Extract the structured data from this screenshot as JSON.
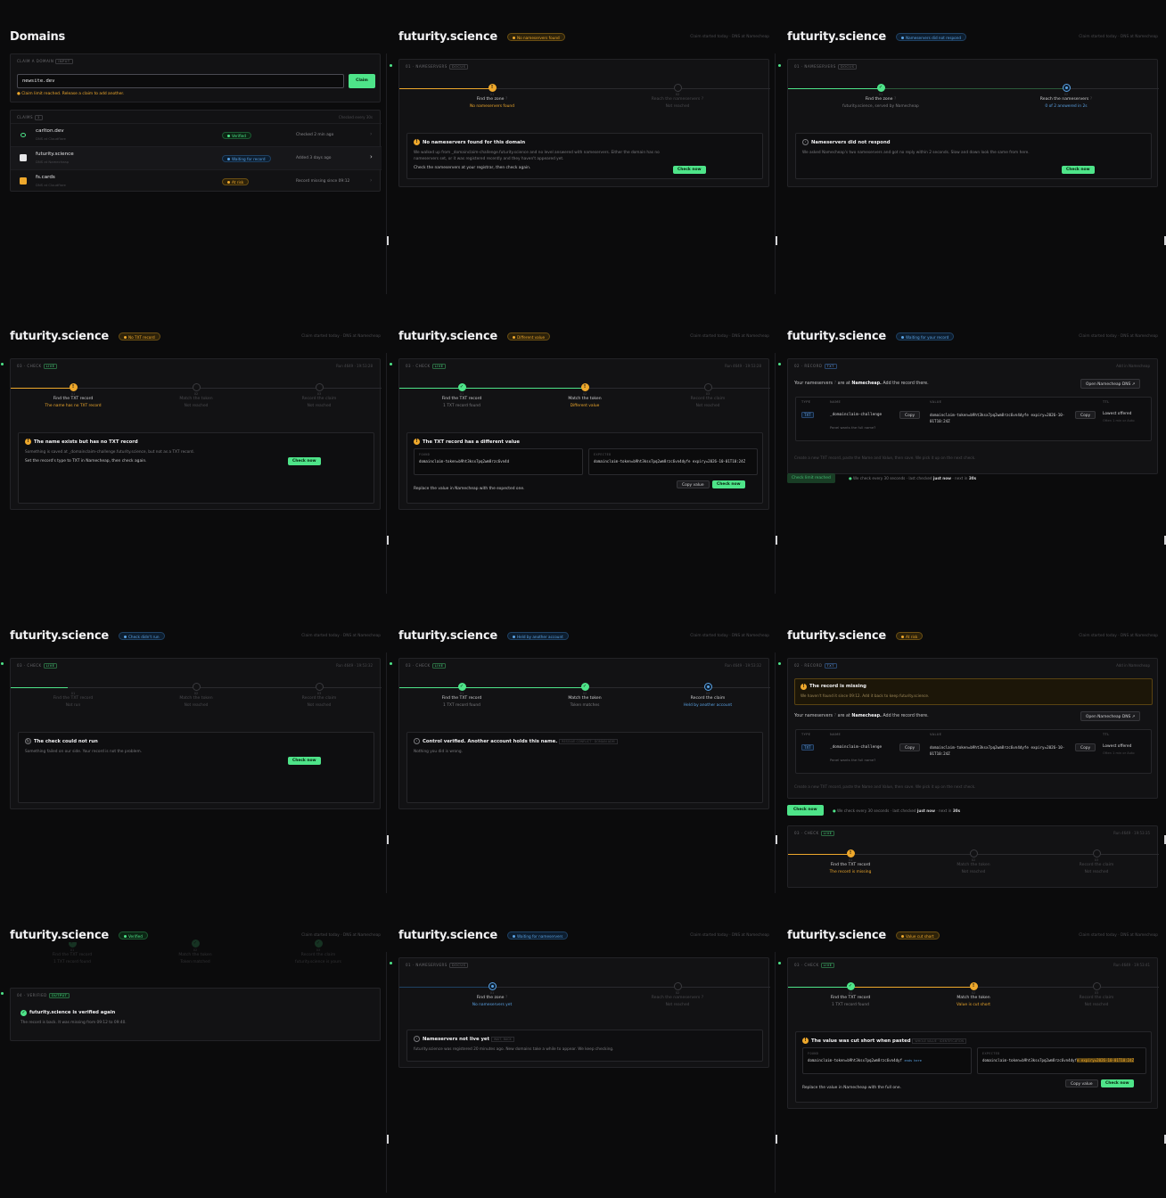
{
  "p1": {
    "title": "Domains",
    "card_label": "CLAIM A DOMAIN",
    "card_tag": "INPUT",
    "input_value": "newsite.dev",
    "claim_btn": "Claim",
    "limit_msg": "Claim limit reached. Release a claim to add another.",
    "claims_label": "CLAIMS",
    "claims_count": "3",
    "checked_every": "Checked every 30s",
    "rows": [
      {
        "name": "carlton.dev",
        "sub": "DNS at Cloudflare",
        "badge": "Verified",
        "status": "Checked 2 min ago"
      },
      {
        "name": "futurity.science",
        "sub": "DNS at Namecheap",
        "badge": "Waiting for record",
        "status": "Added 3 days ago"
      },
      {
        "name": "fs.cards",
        "sub": "DNS at Cloudflare",
        "badge": "At risk",
        "status": "Record missing since 09:12"
      }
    ]
  },
  "common": {
    "domain": "futurity.science",
    "meta": "Claim started today · DNS at Namecheap",
    "ns_head": "01 · NAMESERVERS",
    "ns_tag": "DOCUS",
    "check_head": "03 · CHECK",
    "live": "LIVE",
    "record_head": "02 · RECORD",
    "txt": "TXT",
    "add_at": "Add in Namecheap",
    "verified_head": "04 · VERIFIED",
    "output": "OUTPUT",
    "find_zone": "Find the zone",
    "reach_ns": "Reach the nameservers",
    "find_txt": "Find the TXT record",
    "match_token": "Match the token",
    "record_claim": "Record the claim",
    "not_reached": "Not reached",
    "check_now": "Check now",
    "copy": "Copy",
    "copy_value": "Copy value",
    "found_label": "FOUND",
    "expected_label": "EXPECTED",
    "s01": "01",
    "s02": "02",
    "s03": "03",
    "q": "?"
  },
  "p2": {
    "badge": "No nameservers found",
    "sub1": "No nameservers found",
    "box_title": "No nameservers found for this domain",
    "box_body": "We walked up from _domainclaim-challenge.futurity.science and no level answered with nameservers. Either the domain has no nameservers set, or it was registered recently and they haven't appeared yet.",
    "box_action": "Check the nameservers at your registrar, then check again."
  },
  "p3": {
    "badge": "Nameservers did not respond",
    "sub1": "futurity.science, served by Namecheap",
    "sub2": "0 of 2 answered in 2s",
    "box_title": "Nameservers did not respond",
    "box_body": "We asked Namecheap's two nameservers and got no reply within 2 seconds. Slow and down look the same from here."
  },
  "p4": {
    "badge": "No TXT record",
    "run": "Run 4649 · 19:53:28",
    "sub1": "The name has no TXT record",
    "box_title": "The name exists but has no TXT record",
    "box_body": "Something is saved at _domainclaim-challenge.futurity.science, but not as a TXT record.",
    "box_action": "Set the record's type to TXT in Namecheap, then check again."
  },
  "p5": {
    "badge": "Different value",
    "run": "Run 4649 · 19:53:28",
    "sub1": "1 TXT record found",
    "sub2": "Different value",
    "box_title": "The TXT record has a different value",
    "found": "domainclaim-token=b9ht3ksx7pq2wm8rzc6vn4d",
    "expected": "domainclaim-token=b9ht3ksx7pq2wm8rzc6vn4dyfe expiry=2026-10-01T10:24Z",
    "action": "Replace the value in Namecheap with the expected one."
  },
  "p6": {
    "badge": "Waiting for your record",
    "intro1": "Your nameservers",
    "intro2": "are at",
    "intro3": "Namecheap.",
    "intro4": "Add the record there.",
    "open_btn": "Open Namecheap DNS",
    "col_type": "TYPE",
    "col_name": "NAME",
    "col_value": "VALUE",
    "col_ttl": "TTL",
    "rec_type": "TXT",
    "rec_name": "_domainclaim-challenge",
    "panel_hint": "Panel wants the full name?",
    "rec_value": "domainclaim-token=b9ht3ksx7pq2wm8rzc6vn4dyfe expiry=2026-10-01T10:24Z",
    "ttl": "Lowest offered",
    "ttl_sub": "Often 1 min or Auto",
    "hint": "Create a new TXT record, paste the Name and Value, then save. We pick it up on the next check.",
    "limit_btn": "Check limit reached",
    "poll1": "We check every 30 seconds",
    "poll2": "last checked",
    "poll3": "just now",
    "poll4": "next in",
    "poll5": "30s"
  },
  "p7": {
    "badge": "Check didn't run",
    "run": "Run 4649 · 19:53:32",
    "sub1": "Not run",
    "box_title": "The check could not run",
    "box_body": "Something failed on our side. Your record is not the problem."
  },
  "p8": {
    "badge": "Held by another account",
    "run": "Run 4649 · 19:53:32",
    "sub1": "1 TXT record found",
    "sub2": "Token matches",
    "sub3": "Held by another account",
    "box_title": "Control verified. Another account holds this name.",
    "box_tag": "RESOLVE CONFLICT · DOMAIN ADM",
    "box_body": "Nothing you did is wrong."
  },
  "p9": {
    "badge": "At risk",
    "warn_title": "The record is missing",
    "warn_body": "We haven't found it since 09:12. Add it back to keep futurity.science.",
    "run": "Run 4649 · 19:53:35",
    "sub1": "The record is missing"
  },
  "p10": {
    "badge": "Verified",
    "sub1": "1 TXT record found",
    "sub2": "Token matched",
    "sub3": "futurity.science is yours",
    "box_title": "futurity.science is verified again",
    "box_body": "The record is back. It was missing from 09:12 to 09:40."
  },
  "p11": {
    "badge": "Waiting for nameservers",
    "sub1": "No nameservers yet",
    "box_title": "Nameservers not live yet",
    "box_tag": "WAIT, BACK",
    "box_body": "futurity.science was registered 20 minutes ago. New domains take a while to appear. We keep checking."
  },
  "p12": {
    "badge": "Value cut short",
    "run": "Run 4649 · 19:53:41",
    "sub1": "1 TXT record found",
    "sub2": "Value is cut short",
    "box_title": "The value was cut short when pasted",
    "box_tag": "WHOLE VALUE · IDENTIFICATION",
    "found": "domainclaim-token=b9ht3ksx7pq2wm8rzc6vn4dyf",
    "found_tail": "ends here",
    "expected": "domainclaim-token=b9ht3ksx7pq2wm8rzc6vn4dyf",
    "expected_tail": "e expiry=2026-10-01T10:24Z",
    "action": "Replace the value in Namecheap with the full one."
  },
  "colors": {
    "bg": "#0b0b0c",
    "card": "#121214",
    "green": "#4ee489",
    "amber": "#eea82c",
    "blue": "#5aa2e4"
  }
}
